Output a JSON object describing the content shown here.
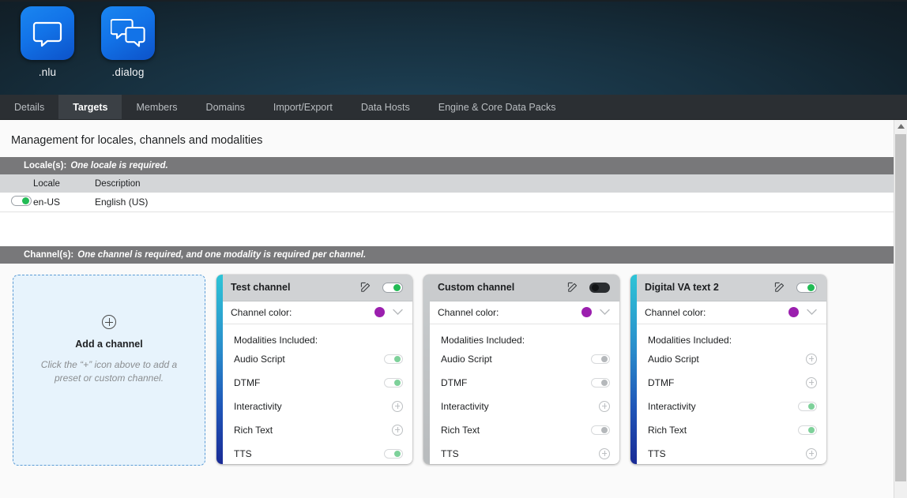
{
  "header": {
    "apps": [
      {
        "label": ".nlu",
        "icon": "chat-bubble-icon"
      },
      {
        "label": ".dialog",
        "icon": "chat-bubbles-icon"
      }
    ]
  },
  "tabs": [
    {
      "label": "Details",
      "active": false
    },
    {
      "label": "Targets",
      "active": true
    },
    {
      "label": "Members",
      "active": false
    },
    {
      "label": "Domains",
      "active": false
    },
    {
      "label": "Import/Export",
      "active": false
    },
    {
      "label": "Data Hosts",
      "active": false
    },
    {
      "label": "Engine & Core Data Packs",
      "active": false
    }
  ],
  "page": {
    "title": "Management for locales, channels and modalities"
  },
  "locales_section": {
    "band_label": "Locale(s):",
    "band_note": "One locale is required.",
    "columns": [
      "Locale",
      "Description"
    ],
    "rows": [
      {
        "enabled": true,
        "locale": "en-US",
        "description": "English (US)"
      }
    ]
  },
  "channels_section": {
    "band_label": "Channel(s):",
    "band_note": "One channel is required, and one modality is required per channel.",
    "add_card": {
      "icon": "plus-circle-icon",
      "title": "Add a channel",
      "subtitle": "Click the “+” icon above to add a preset or custom channel."
    },
    "color_label": "Channel color:",
    "modalities_label": "Modalities Included:",
    "accent_gradient_start": "#2ec4d6",
    "accent_gradient_end": "#1a2b96",
    "swatch_color": "#9b1fae",
    "cards": [
      {
        "name": "Test channel",
        "enabled": true,
        "swatch": "#9b1fae",
        "modalities": [
          {
            "label": "Audio Script",
            "state": "on"
          },
          {
            "label": "DTMF",
            "state": "on"
          },
          {
            "label": "Interactivity",
            "state": "add"
          },
          {
            "label": "Rich Text",
            "state": "add"
          },
          {
            "label": "TTS",
            "state": "on"
          }
        ]
      },
      {
        "name": "Custom channel",
        "enabled": false,
        "swatch": "#9b1fae",
        "modalities": [
          {
            "label": "Audio Script",
            "state": "on-disabled"
          },
          {
            "label": "DTMF",
            "state": "on-disabled"
          },
          {
            "label": "Interactivity",
            "state": "add"
          },
          {
            "label": "Rich Text",
            "state": "on-disabled"
          },
          {
            "label": "TTS",
            "state": "add"
          }
        ]
      },
      {
        "name": "Digital VA text 2",
        "enabled": true,
        "swatch": "#9b1fae",
        "modalities": [
          {
            "label": "Audio Script",
            "state": "add"
          },
          {
            "label": "DTMF",
            "state": "add"
          },
          {
            "label": "Interactivity",
            "state": "on"
          },
          {
            "label": "Rich Text",
            "state": "on"
          },
          {
            "label": "TTS",
            "state": "add"
          }
        ]
      }
    ]
  },
  "scrollbar": {
    "up_arrow_icon": "caret-up-icon"
  }
}
